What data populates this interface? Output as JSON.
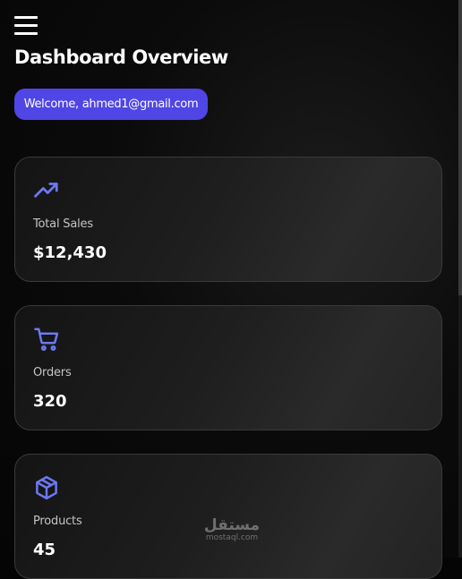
{
  "header": {
    "menu_icon": "hamburger-menu-icon",
    "title": "Dashboard Overview",
    "welcome": "Welcome, ahmed1@gmail.com"
  },
  "colors": {
    "accent": "#4f46e5",
    "icon": "#6d78f0",
    "background": "#050505",
    "card_border": "#3a3a3a"
  },
  "cards": [
    {
      "icon": "trending-up-icon",
      "label": "Total Sales",
      "value": "$12,430"
    },
    {
      "icon": "shopping-cart-icon",
      "label": "Orders",
      "value": "320"
    },
    {
      "icon": "package-box-icon",
      "label": "Products",
      "value": "45"
    }
  ],
  "watermark": {
    "arabic": "مستقل",
    "domain": "mostaql.com"
  }
}
